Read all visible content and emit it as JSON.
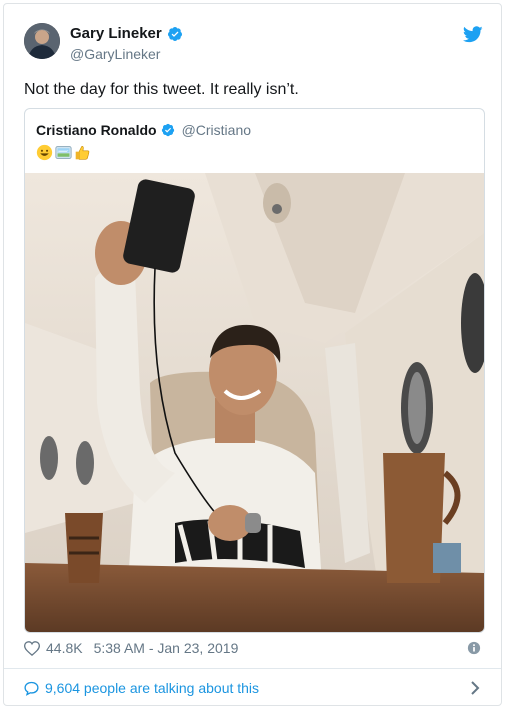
{
  "author": {
    "name": "Gary Lineker",
    "handle": "@GaryLineker"
  },
  "tweet_text": "Not the day for this tweet. It really isn’t.",
  "quoted": {
    "name": "Cristiano Ronaldo",
    "handle": "@Cristiano",
    "emojis": [
      "grinning-face-emoji",
      "airplane-window-emoji",
      "thumbs-up-emoji"
    ],
    "photo": "man-taking-selfie-in-private-jet-cabin"
  },
  "stats": {
    "likes": "44.8K",
    "timestamp": "5:38 AM - Jan 23, 2019"
  },
  "footer": {
    "talking": "9,604 people are talking about this"
  },
  "colors": {
    "brand": "#1da1f2",
    "link": "#1b95e0",
    "muted": "#657786",
    "text": "#14171a",
    "border": "#e1e8ed"
  },
  "icons": [
    "verified-badge-icon",
    "twitter-logo-icon",
    "heart-icon",
    "info-icon",
    "speech-bubble-icon",
    "chevron-right-icon"
  ]
}
